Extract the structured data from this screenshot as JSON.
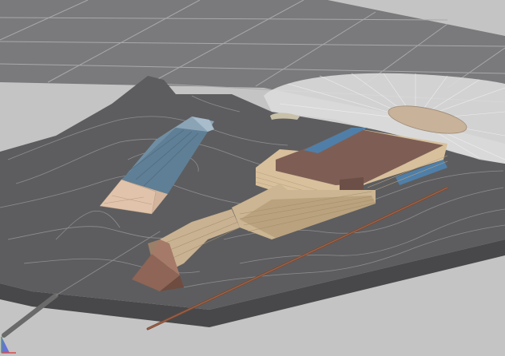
{
  "viewport": {
    "background_color": "#c4c4c4",
    "grid_plane_color": "#7a7a7c",
    "grid_line_color": "#a9a9ab",
    "terrain_color": "#5d5d5f",
    "terrain_side_color": "#48484a",
    "contour_color": "#9a9a9c",
    "radial_fan_color": "#dcdcdc",
    "models": [
      {
        "name": "blue-roof-building",
        "roof_color": "#5f7f96",
        "end_color": "#d3b49c"
      },
      {
        "name": "main-plant-building",
        "roof_color": "#7e5e54",
        "wall_color": "#d8c09c",
        "accent_color": "#4f7fa8"
      },
      {
        "name": "stepped-wall-structure",
        "color": "#cbb592"
      },
      {
        "name": "silo-cone",
        "color": "#8e6556"
      },
      {
        "name": "pipe-conveyor",
        "color": "#7a4a35"
      },
      {
        "name": "grey-pipe",
        "color": "#6a6a6a"
      },
      {
        "name": "stockpile-dome",
        "color": "#c8b29a"
      }
    ],
    "axis_icon": "view-axis-tripod-icon"
  }
}
